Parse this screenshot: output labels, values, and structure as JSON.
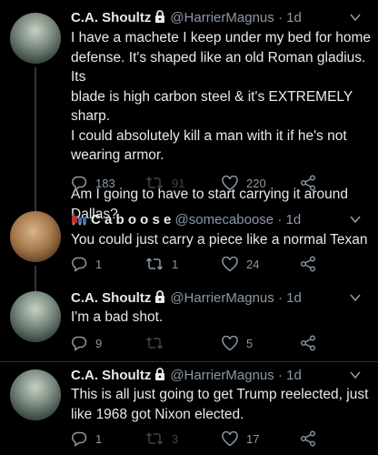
{
  "tweets": [
    {
      "name": "C.A. Shoultz",
      "handle": "@HarrierMagnus",
      "dot": "·",
      "time": "1d",
      "text_lines": [
        "I have a machete I keep under my bed for home",
        "defense.  It's shaped like an old Roman gladius.  Its",
        "blade is high carbon steel & it's EXTREMELY sharp.",
        "I could absolutely kill a man with it if he's not",
        "wearing armor.",
        "",
        "Am I going to have to start carrying it around",
        "Dallas?"
      ],
      "replies": "183",
      "retweets": "91",
      "likes": "220"
    },
    {
      "name": "C a b o o s e",
      "handle": "@somecaboose",
      "dot": "·",
      "time": "1d",
      "text_lines": [
        "You could just carry a piece like a normal Texan"
      ],
      "replies": "1",
      "retweets": "1",
      "likes": "24"
    },
    {
      "name": "C.A. Shoultz",
      "handle": "@HarrierMagnus",
      "dot": "·",
      "time": "1d",
      "text_lines": [
        "I'm a bad shot."
      ],
      "replies": "9",
      "retweets": "",
      "likes": "5"
    },
    {
      "name": "C.A. Shoultz",
      "handle": "@HarrierMagnus",
      "dot": "·",
      "time": "1d",
      "text_lines": [
        "This is all just going to get Trump reelected, just",
        "like 1968 got Nixon elected."
      ],
      "replies": "1",
      "retweets": "3",
      "likes": "17"
    }
  ],
  "icons": {
    "reply": "reply-icon",
    "retweet": "retweet-icon",
    "like": "heart-icon",
    "share": "share-icon",
    "lock": "lock-icon",
    "chevron": "chevron-down-icon"
  },
  "colors": {
    "background": "#000000",
    "text": "#e7e9ea",
    "muted": "#8b98a5",
    "divider": "#2f3336"
  }
}
